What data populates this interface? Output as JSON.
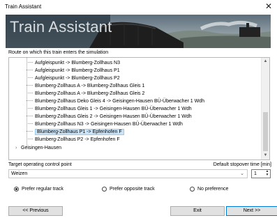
{
  "window": {
    "title": "Train Assistant",
    "close_glyph": "✕"
  },
  "banner": {
    "title": "Train Assistant"
  },
  "route": {
    "label": "Route on which this train enters the simulation",
    "items": [
      {
        "text": "Aufgleispunkt -> Blumberg-Zollhaus N3",
        "selected": false
      },
      {
        "text": "Aufgleispunkt -> Blumberg-Zollhaus P1",
        "selected": false
      },
      {
        "text": "Aufgleispunkt -> Blumberg-Zollhaus P2",
        "selected": false
      },
      {
        "text": "Blumberg-Zollhaus A -> Blumberg-Zollhaus Gleis 1",
        "selected": false
      },
      {
        "text": "Blumberg-Zollhaus A -> Blumberg-Zollhaus Gleis 2",
        "selected": false
      },
      {
        "text": "Blumberg-Zollhaus Deko Gleis 4 -> Geisingen-Hausen BÜ-Überwacher 1 Wdh",
        "selected": false
      },
      {
        "text": "Blumberg-Zollhaus Gleis 1 -> Geisingen-Hausen BÜ-Überwacher 1 Wdh",
        "selected": false
      },
      {
        "text": "Blumberg-Zollhaus Gleis 2 -> Geisingen-Hausen BÜ-Überwacher 1 Wdh",
        "selected": false
      },
      {
        "text": "Blumberg-Zollhaus N3 -> Geisingen-Hausen BÜ-Überwacher 1 Wdh",
        "selected": false
      },
      {
        "text": "Blumberg-Zollhaus P1 -> Epfenhofen F",
        "selected": true
      },
      {
        "text": "Blumberg-Zollhaus P2 -> Epfenhofen F",
        "selected": false
      }
    ],
    "group": {
      "text": "Geisingen-Hausen",
      "chevron": "›"
    },
    "scroll": {
      "up": "▲",
      "down": "▼"
    }
  },
  "target": {
    "label": "Target operating control point",
    "value": "Weizen",
    "dropdown_glyph": "⌄"
  },
  "stopover": {
    "label": "Default stopover time [min]",
    "value": "1",
    "up": "▲",
    "down": "▼"
  },
  "track_options": [
    {
      "label": "Prefer regular track",
      "checked": true
    },
    {
      "label": "Prefer opposite track",
      "checked": false
    },
    {
      "label": "No preference",
      "checked": false
    }
  ],
  "buttons": {
    "previous": "<< Previous",
    "exit": "Exit",
    "next": "Next >>"
  }
}
